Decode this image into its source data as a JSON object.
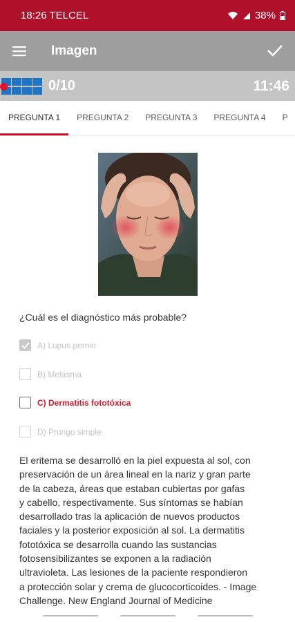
{
  "status": {
    "time_carrier": "18:26 TELCEL",
    "battery": "38%"
  },
  "appbar": {
    "title": "Imagen"
  },
  "progress": {
    "count": "0/10",
    "timer": "11:46",
    "answered_fraction": 0.0
  },
  "tabs": [
    {
      "label": "PREGUNTA 1"
    },
    {
      "label": "PREGUNTA 2"
    },
    {
      "label": "PREGUNTA 3"
    },
    {
      "label": "PREGUNTA 4"
    },
    {
      "label": "P"
    }
  ],
  "question": {
    "text": "¿Cuál es el diagnóstico más probable?",
    "options": [
      {
        "label": "A) Lupus pernio",
        "state": "selected"
      },
      {
        "label": "B) Melasma",
        "state": "unselected"
      },
      {
        "label": "C) Dermatitis fototóxica",
        "state": "correct"
      },
      {
        "label": "D) Prurigo simple",
        "state": "unselected"
      }
    ]
  },
  "explanation": {
    "lines": [
      "El eritema se desarrolló en la piel expuesta al sol, con",
      "preservación de un área lineal en la nariz y gran parte",
      "de la cabeza, áreas que estaban cubiertas por gafas",
      "y cabello, respectivamente. Sus síntomas se habían",
      "desarrollado tras la aplicación de nuevos productos",
      "faciales y la posterior exposición al sol. La dermatitis",
      "fototóxica se desarrolla cuando las sustancias",
      "fotosensibilizantes se exponen a la radiación",
      "ultravioleta. Las lesiones de la paciente respondieron",
      "a protección solar y crema de glucocorticoides. - Image",
      "Challenge. New England Journal of Medicine"
    ]
  },
  "colors": {
    "brand_red": "#b0102a",
    "appbar_gray": "#9e9e9e",
    "progress_gray": "#c4c4c4",
    "grid_blue": "#1e74c5",
    "correct_red": "#d21a2e"
  },
  "icons": {
    "menu": "menu-icon",
    "confirm": "check-icon",
    "wifi": "wifi-icon",
    "signal": "signal-icon",
    "battery": "battery-icon"
  }
}
